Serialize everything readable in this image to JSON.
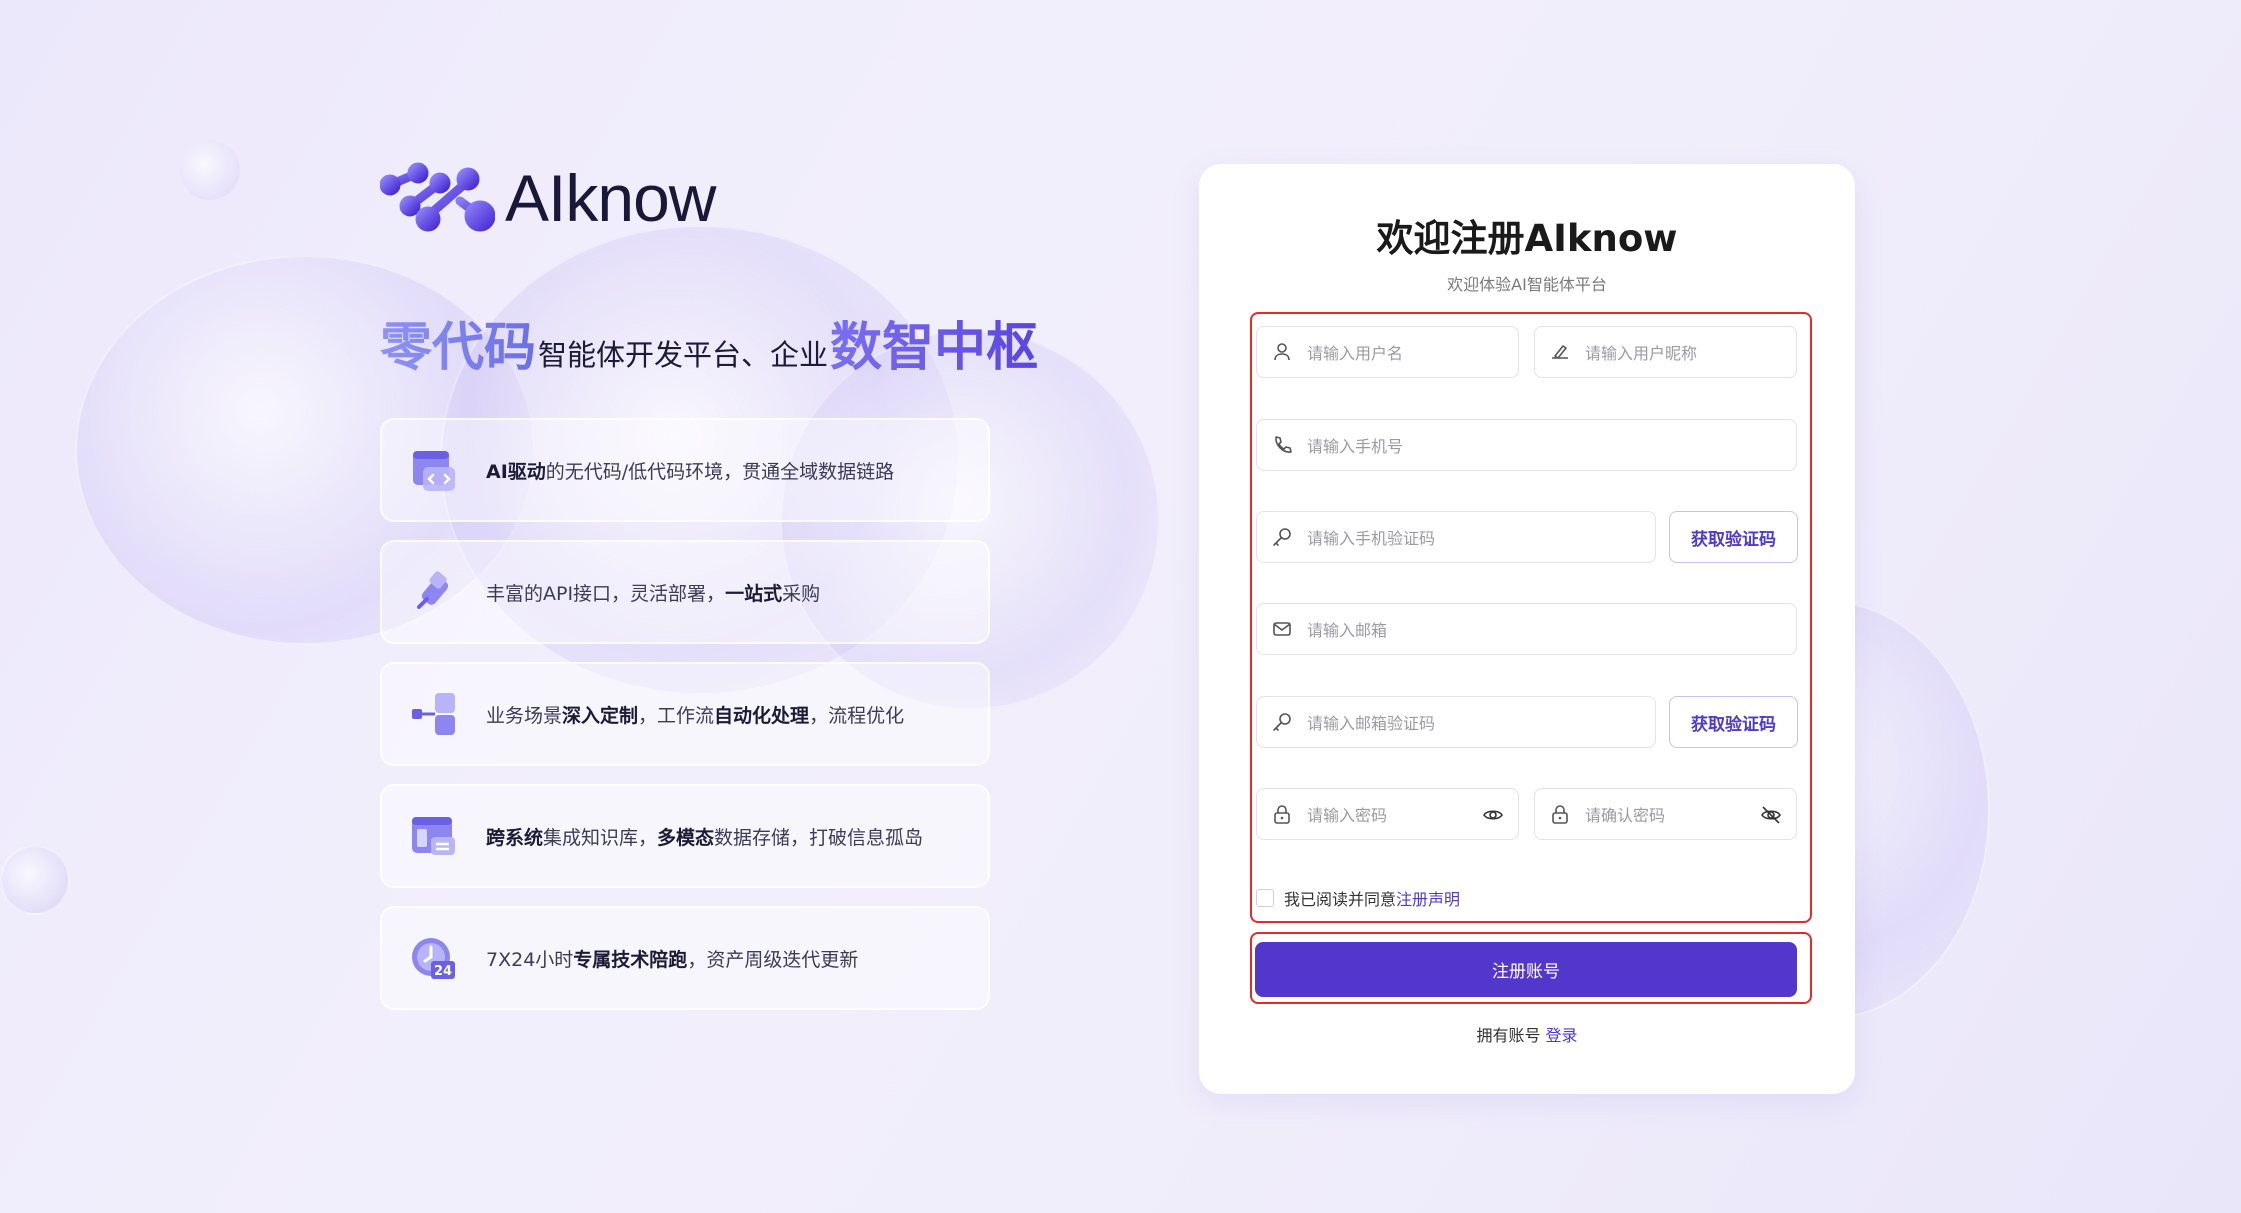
{
  "brand": {
    "name": "AIknow"
  },
  "slogan": {
    "part1": "零代码",
    "part2": "智能体开发平台、企业",
    "part3": "数智中枢"
  },
  "features": [
    {
      "icon": "code-window-icon",
      "segments": [
        {
          "text": "AI驱动",
          "bold": true
        },
        {
          "text": "的无代码/低代码环境，贯通全域数据链路",
          "bold": false
        }
      ]
    },
    {
      "icon": "api-plug-icon",
      "segments": [
        {
          "text": "丰富的API接口，灵活部署，",
          "bold": false
        },
        {
          "text": "一站式",
          "bold": true
        },
        {
          "text": "采购",
          "bold": false
        }
      ]
    },
    {
      "icon": "workflow-icon",
      "segments": [
        {
          "text": "业务场景",
          "bold": false
        },
        {
          "text": "深入定制",
          "bold": true
        },
        {
          "text": "，工作流",
          "bold": false
        },
        {
          "text": "自动化处理",
          "bold": true
        },
        {
          "text": "，流程优化",
          "bold": false
        }
      ]
    },
    {
      "icon": "multi-system-icon",
      "segments": [
        {
          "text": "跨系统",
          "bold": true
        },
        {
          "text": "集成知识库，",
          "bold": false
        },
        {
          "text": "多模态",
          "bold": true
        },
        {
          "text": "数据存储，打破信息孤岛",
          "bold": false
        }
      ]
    },
    {
      "icon": "clock-24-icon",
      "segments": [
        {
          "text": "7X24小时",
          "bold": false
        },
        {
          "text": "专属技术陪跑",
          "bold": true
        },
        {
          "text": "，资产周级迭代更新",
          "bold": false
        }
      ]
    }
  ],
  "register": {
    "title": "欢迎注册AIknow",
    "subtitle": "欢迎体验AI智能体平台",
    "username_placeholder": "请输入用户名",
    "nickname_placeholder": "请输入用户昵称",
    "phone_placeholder": "请输入手机号",
    "phone_code_placeholder": "请输入手机验证码",
    "get_code_label": "获取验证码",
    "email_placeholder": "请输入邮箱",
    "email_code_placeholder": "请输入邮箱验证码",
    "password_placeholder": "请输入密码",
    "confirm_password_placeholder": "请确认密码",
    "agree_text": "我已阅读并同意",
    "agree_link": "注册声明",
    "submit_label": "注册账号",
    "has_account_text": "拥有账号",
    "login_link": "登录"
  },
  "colors": {
    "accent": "#5337cc",
    "highlight_box": "#e52a2a"
  }
}
